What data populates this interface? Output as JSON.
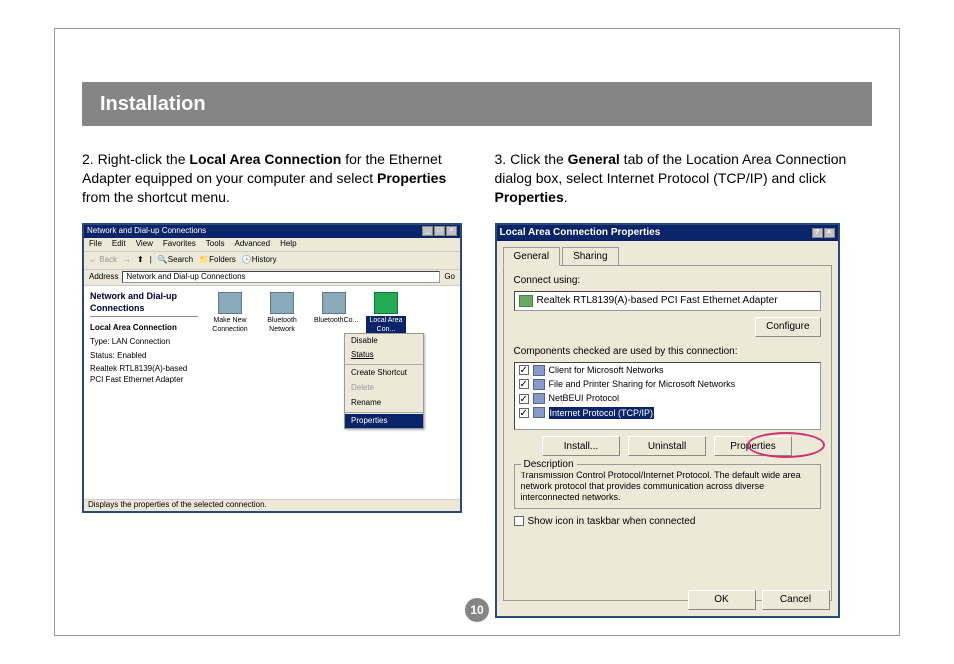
{
  "page": {
    "section_title": "Installation",
    "page_number": "10"
  },
  "step2": {
    "num": "2. ",
    "t1": "Right-click the ",
    "b1": "Local Area Connection",
    "t2": " for the Ethernet Adapter equipped on your computer and select ",
    "b2": "Properties",
    "t3": " from the shortcut menu."
  },
  "step3": {
    "num": "3. ",
    "t1": "Click the ",
    "b1": "General",
    "t2": " tab of the Location Area Connection dialog box, select Internet Protocol (TCP/IP) and click ",
    "b2": "Properties",
    "t3": "."
  },
  "win1": {
    "title": "Network and Dial-up Connections",
    "menu": [
      "File",
      "Edit",
      "View",
      "Favorites",
      "Tools",
      "Advanced",
      "Help"
    ],
    "toolbar": {
      "back": "Back",
      "search": "Search",
      "folders": "Folders",
      "history": "History"
    },
    "address_label": "Address",
    "address_value": "Network and Dial-up Connections",
    "go": "Go",
    "sidebar": {
      "heading": "Network and Dial-up Connections",
      "label": "Local Area Connection",
      "type_label": "Type: LAN Connection",
      "status_label": "Status: Enabled",
      "device": "Realtek RTL8139(A)-based PCI Fast Ethernet Adapter"
    },
    "icons": {
      "make_new": "Make New Connection",
      "bt_net": "Bluetooth Network",
      "bt_co": "BluetoothCo...",
      "lac": "Local Area Con..."
    },
    "ctx": {
      "disable": "Disable",
      "status": "Status",
      "shortcut": "Create Shortcut",
      "delete": "Delete",
      "rename": "Rename",
      "properties": "Properties"
    },
    "statusbar": "Displays the properties of the selected connection."
  },
  "dlg": {
    "title": "Local Area Connection Properties",
    "tabs": {
      "general": "General",
      "sharing": "Sharing"
    },
    "connect_using": "Connect using:",
    "adapter": "Realtek RTL8139(A)-based PCI Fast Ethernet Adapter",
    "configure": "Configure",
    "components_label": "Components checked are used by this connection:",
    "components": {
      "c1": "Client for Microsoft Networks",
      "c2": "File and Printer Sharing for Microsoft Networks",
      "c3": "NetBEUI Protocol",
      "c4": "Internet Protocol (TCP/IP)"
    },
    "buttons": {
      "install": "Install...",
      "uninstall": "Uninstall",
      "properties": "Properties",
      "ok": "OK",
      "cancel": "Cancel"
    },
    "desc_label": "Description",
    "desc_text": "Transmission Control Protocol/Internet Protocol. The default wide area network protocol that provides communication across diverse interconnected networks.",
    "show_icon": "Show icon in taskbar when connected"
  }
}
